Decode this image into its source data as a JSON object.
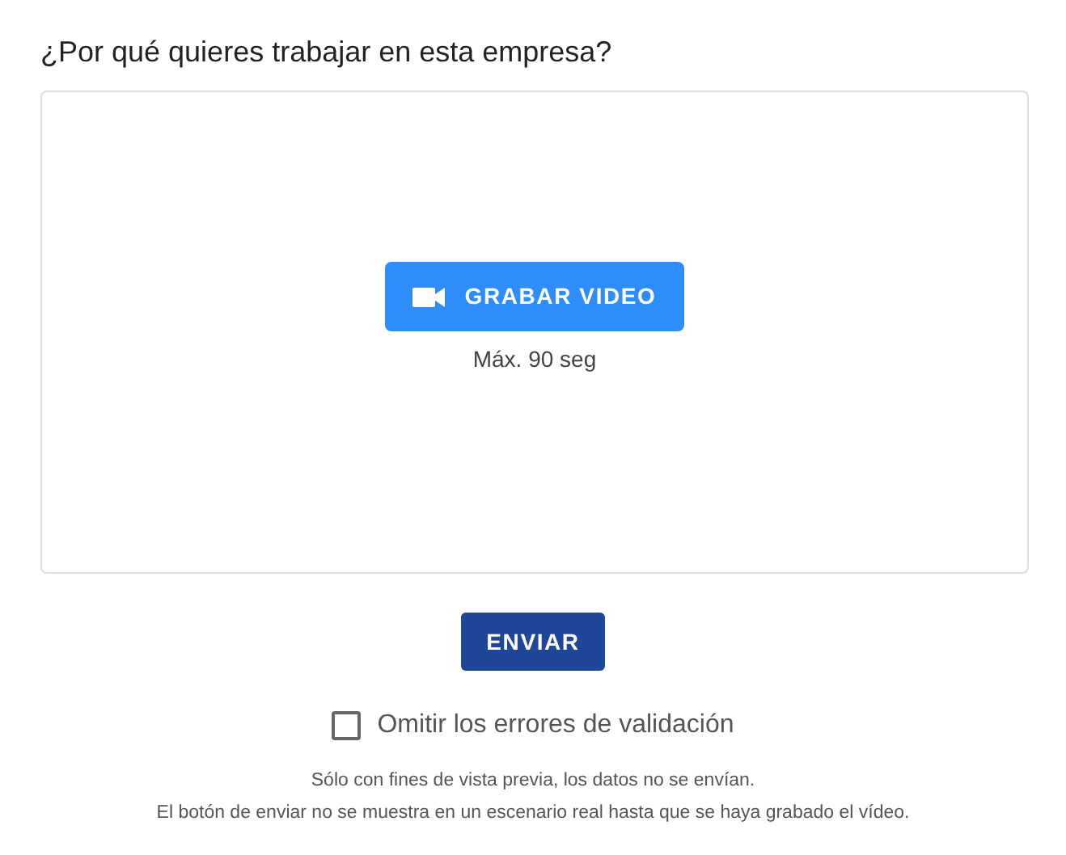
{
  "question": "¿Por qué quieres trabajar en esta empresa?",
  "record": {
    "label": "GRABAR VIDEO",
    "limit": "Máx. 90 seg"
  },
  "submit": {
    "label": "ENVIAR"
  },
  "skip_validation": {
    "label": "Omitir los errores de validación",
    "checked": false
  },
  "notes": [
    "Sólo con fines de vista previa, los datos no se envían.",
    "El botón de enviar no se muestra en un escenario real hasta que se haya grabado el vídeo."
  ]
}
